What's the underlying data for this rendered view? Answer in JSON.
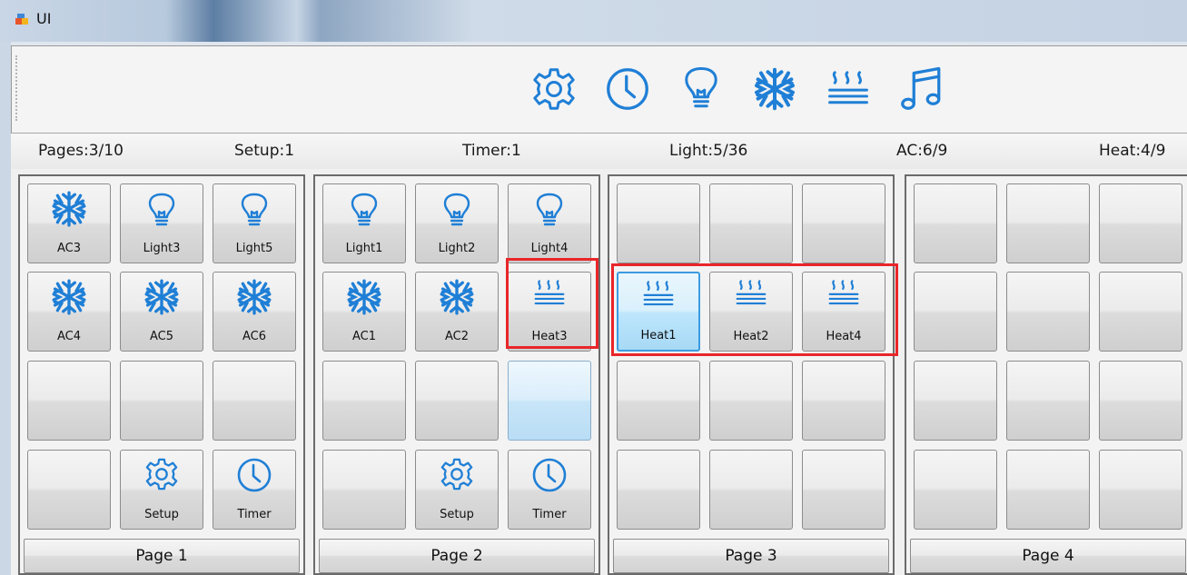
{
  "window": {
    "title": "UI"
  },
  "toolbar": {
    "icons": [
      "gear-icon",
      "clock-icon",
      "lightbulb-icon",
      "snowflake-icon",
      "heater-icon",
      "music-note-icon"
    ]
  },
  "status": {
    "pages": "Pages:3/10",
    "setup": "Setup:1",
    "timer": "Timer:1",
    "light": "Light:5/36",
    "ac": "AC:6/9",
    "heat": "Heat:4/9"
  },
  "pages": [
    {
      "label": "Page 1",
      "buttons": [
        {
          "label": "AC3",
          "icon": "snowflake"
        },
        {
          "label": "Light3",
          "icon": "bulb"
        },
        {
          "label": "Light5",
          "icon": "bulb"
        },
        {
          "label": "AC4",
          "icon": "snowflake"
        },
        {
          "label": "AC5",
          "icon": "snowflake"
        },
        {
          "label": "AC6",
          "icon": "snowflake"
        },
        {
          "label": "",
          "icon": ""
        },
        {
          "label": "",
          "icon": ""
        },
        {
          "label": "",
          "icon": ""
        },
        {
          "label": "",
          "icon": ""
        },
        {
          "label": "Setup",
          "icon": "gear"
        },
        {
          "label": "Timer",
          "icon": "clock"
        }
      ]
    },
    {
      "label": "Page 2",
      "buttons": [
        {
          "label": "Light1",
          "icon": "bulb"
        },
        {
          "label": "Light2",
          "icon": "bulb"
        },
        {
          "label": "Light4",
          "icon": "bulb"
        },
        {
          "label": "AC1",
          "icon": "snowflake"
        },
        {
          "label": "AC2",
          "icon": "snowflake"
        },
        {
          "label": "Heat3",
          "icon": "heat"
        },
        {
          "label": "",
          "icon": ""
        },
        {
          "label": "",
          "icon": ""
        },
        {
          "label": "",
          "icon": "",
          "state": "hover"
        },
        {
          "label": "",
          "icon": ""
        },
        {
          "label": "Setup",
          "icon": "gear"
        },
        {
          "label": "Timer",
          "icon": "clock"
        }
      ]
    },
    {
      "label": "Page 3",
      "buttons": [
        {
          "label": "",
          "icon": ""
        },
        {
          "label": "",
          "icon": ""
        },
        {
          "label": "",
          "icon": ""
        },
        {
          "label": "Heat1",
          "icon": "heat",
          "state": "selected"
        },
        {
          "label": "Heat2",
          "icon": "heat"
        },
        {
          "label": "Heat4",
          "icon": "heat"
        },
        {
          "label": "",
          "icon": ""
        },
        {
          "label": "",
          "icon": ""
        },
        {
          "label": "",
          "icon": ""
        },
        {
          "label": "",
          "icon": ""
        },
        {
          "label": "",
          "icon": ""
        },
        {
          "label": "",
          "icon": ""
        }
      ]
    },
    {
      "label": "Page 4",
      "buttons": [
        {
          "label": "",
          "icon": ""
        },
        {
          "label": "",
          "icon": ""
        },
        {
          "label": "",
          "icon": ""
        },
        {
          "label": "",
          "icon": ""
        },
        {
          "label": "",
          "icon": ""
        },
        {
          "label": "",
          "icon": ""
        },
        {
          "label": "",
          "icon": ""
        },
        {
          "label": "",
          "icon": ""
        },
        {
          "label": "",
          "icon": ""
        },
        {
          "label": "",
          "icon": ""
        },
        {
          "label": "",
          "icon": ""
        },
        {
          "label": "",
          "icon": ""
        }
      ]
    }
  ],
  "colors": {
    "icon": "#1f7fd6",
    "highlight": "#e8262a",
    "selected_border": "#3c9be0"
  }
}
